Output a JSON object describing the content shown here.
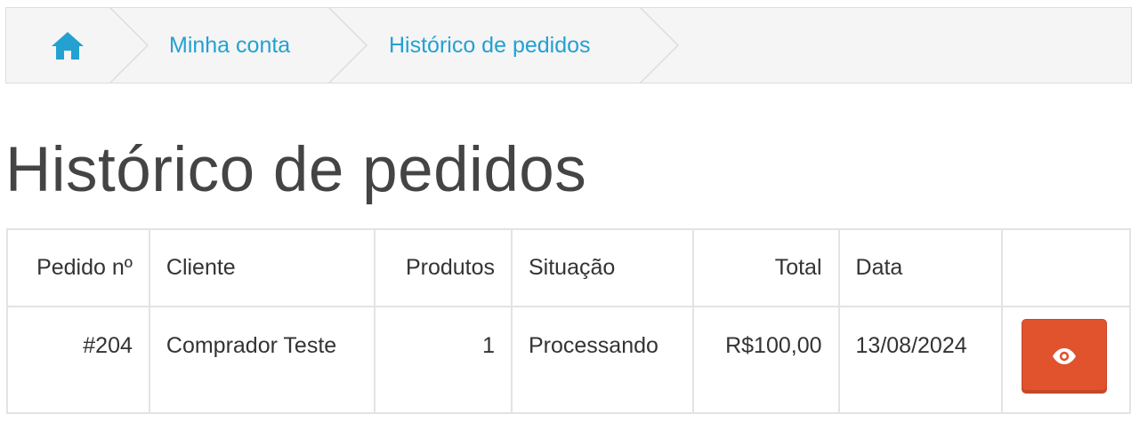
{
  "breadcrumb": {
    "home_icon": "home-icon",
    "items": [
      {
        "label": "Minha conta"
      },
      {
        "label": "Histórico de pedidos"
      }
    ],
    "link_color": "#23a1d1"
  },
  "page": {
    "title": "Histórico de pedidos"
  },
  "orders_table": {
    "headers": {
      "order_id": "Pedido nº",
      "customer": "Cliente",
      "products": "Produtos",
      "status": "Situação",
      "total": "Total",
      "date": "Data"
    },
    "rows": [
      {
        "order_id": "#204",
        "customer": "Comprador Teste",
        "products": "1",
        "status": "Processando",
        "total": "R$100,00",
        "date": "13/08/2024",
        "action_icon": "eye-icon",
        "action_color": "#e0532d"
      }
    ]
  }
}
